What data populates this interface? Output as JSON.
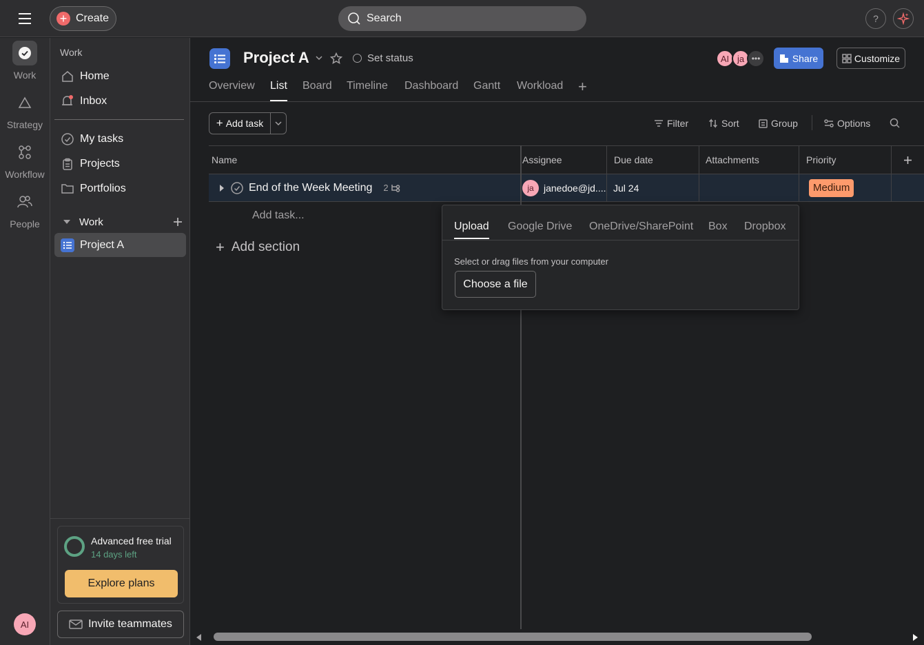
{
  "topbar": {
    "create_label": "Create",
    "search_placeholder": "Search",
    "help_label": "?"
  },
  "rail": {
    "items": [
      {
        "label": "Work",
        "icon": "check-circle-icon"
      },
      {
        "label": "Strategy",
        "icon": "triangle-icon"
      },
      {
        "label": "Workflow",
        "icon": "workflow-icon"
      },
      {
        "label": "People",
        "icon": "people-icon"
      }
    ],
    "user_initials": "AI"
  },
  "sidebar": {
    "section_label": "Work",
    "nav": [
      {
        "label": "Home",
        "icon": "home-icon"
      },
      {
        "label": "Inbox",
        "icon": "bell-icon"
      }
    ],
    "nav2": [
      {
        "label": "My tasks",
        "icon": "check-circle-icon"
      },
      {
        "label": "Projects",
        "icon": "clipboard-icon"
      },
      {
        "label": "Portfolios",
        "icon": "folder-icon"
      }
    ],
    "work_section": "Work",
    "project": "Project A",
    "trial": {
      "title": "Advanced free trial",
      "days_left": "14 days left",
      "explore_label": "Explore plans"
    },
    "invite_label": "Invite teammates"
  },
  "project": {
    "title": "Project A",
    "set_status": "Set status",
    "members": [
      "AI",
      "ja"
    ],
    "share_label": "Share",
    "customize_label": "Customize",
    "tabs": [
      "Overview",
      "List",
      "Board",
      "Timeline",
      "Dashboard",
      "Gantt",
      "Workload"
    ],
    "active_tab": "List"
  },
  "toolbar": {
    "add_task_label": "Add task",
    "filter": "Filter",
    "sort": "Sort",
    "group": "Group",
    "options": "Options"
  },
  "table": {
    "columns": [
      "Name",
      "Assignee",
      "Due date",
      "Attachments",
      "Priority"
    ],
    "rows": [
      {
        "name": "End of the Week Meeting",
        "subtask_count": "2",
        "assignee_initials": "ja",
        "assignee": "janedoe@jd....",
        "due": "Jul 24",
        "attachments": "",
        "priority": "Medium"
      }
    ],
    "add_task_inline": "Add task...",
    "add_section": "Add section"
  },
  "attach_popover": {
    "tabs": [
      "Upload",
      "Google Drive",
      "OneDrive/SharePoint",
      "Box",
      "Dropbox"
    ],
    "active_tab": "Upload",
    "hint": "Select or drag files from your computer",
    "choose_label": "Choose a file"
  },
  "colors": {
    "accent_blue": "#4573d2",
    "create_red": "#f06a6a",
    "priority_medium": "#fd9a6c",
    "trial_green": "#5da283",
    "explore_orange": "#f1bd6c"
  }
}
